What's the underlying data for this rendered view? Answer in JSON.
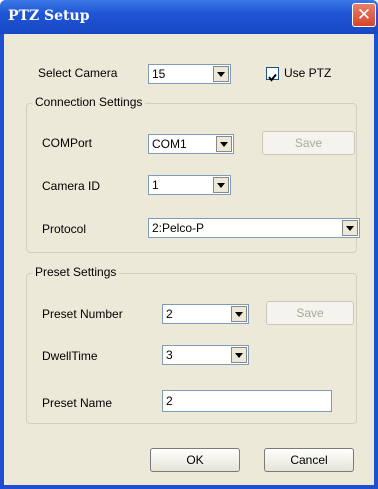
{
  "window": {
    "title": "PTZ Setup",
    "close_glyph": "✕"
  },
  "top": {
    "select_camera_label": "Select Camera",
    "select_camera_value": "15",
    "use_ptz_label": "Use PTZ",
    "use_ptz_checked": true
  },
  "connection": {
    "group_title": "Connection Settings",
    "comport_label": "COMPort",
    "comport_value": "COM1",
    "save_label": "Save",
    "camera_id_label": "Camera ID",
    "camera_id_value": "1",
    "protocol_label": "Protocol",
    "protocol_value": "2:Pelco-P"
  },
  "preset": {
    "group_title": "Preset Settings",
    "number_label": "Preset Number",
    "number_value": "2",
    "save_label": "Save",
    "dwell_label": "DwellTime",
    "dwell_value": "3",
    "name_label": "Preset Name",
    "name_value": "2"
  },
  "footer": {
    "ok_label": "OK",
    "cancel_label": "Cancel"
  },
  "colors": {
    "titlebar": "#1f55d6",
    "client": "#ece9d8",
    "close": "#d3452b"
  },
  "icons": {
    "close": "close-icon",
    "dropdown": "chevron-down-icon",
    "check": "checkmark-icon"
  }
}
